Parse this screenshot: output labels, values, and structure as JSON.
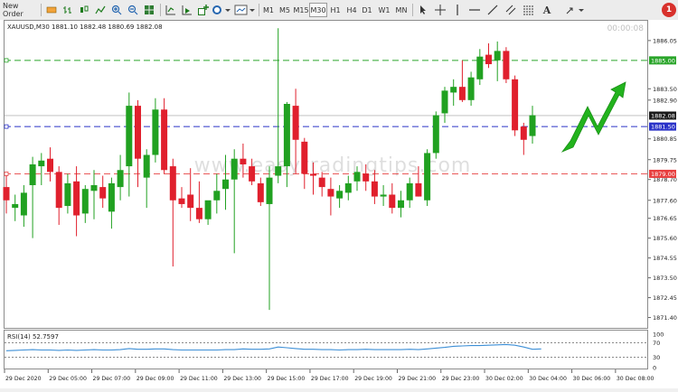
{
  "toolbar": {
    "new_order_label": "New Order",
    "timeframes": [
      "M1",
      "M5",
      "M15",
      "M30",
      "H1",
      "H4",
      "D1",
      "W1",
      "MN"
    ],
    "active_timeframe": "M30",
    "alert_badge": "1",
    "icons": [
      "auto-trading-icon",
      "bars-chart-icon",
      "candles-chart-icon",
      "line-chart-icon",
      "zoom-in-icon",
      "zoom-out-icon",
      "tile-windows-icon",
      "auto-scroll-icon",
      "chart-shift-icon",
      "indicators-icon",
      "period-icon",
      "templates-icon",
      "cursor-icon",
      "crosshair-icon",
      "vertical-line-icon",
      "horizontal-line-icon",
      "trendline-icon",
      "channel-icon",
      "fibonacci-icon",
      "text-icon",
      "arrows-icon"
    ]
  },
  "chart": {
    "header": "XAUUSD,M30  1881.10 1882.48 1880.69 1882.08",
    "timer": "00:00:08",
    "watermark": "www.easytradingtips.com",
    "rsi_label": "RSI(14) 52.7597",
    "colors": {
      "bull": "#21a121",
      "bear": "#e0202d",
      "rsi": "#3d8fd6",
      "green_line": "#2aa52a",
      "blue_line": "#2b33c8",
      "red_line": "#e84040",
      "arrow": "#22b31d"
    }
  },
  "chart_data": {
    "type": "candlestick",
    "symbol": "XAUUSD",
    "timeframe": "M30",
    "ylim": [
      1870.9,
      1887.0
    ],
    "price_ticks": [
      "1886.05",
      "1883.50",
      "1882.90",
      "1880.85",
      "1879.75",
      "1878.70",
      "1877.60",
      "1876.65",
      "1875.60",
      "1874.55",
      "1873.50",
      "1872.45",
      "1871.40"
    ],
    "price_labels": [
      "1886.05",
      "1883.50",
      "1882.90",
      "1880.85",
      "1879.75",
      "1878.70",
      "1877.60",
      "1876.65",
      "1875.60",
      "1874.55",
      "1873.50",
      "1872.45",
      "1871.40"
    ],
    "x_labels": [
      "29 Dec 2020",
      "29 Dec 05:00",
      "29 Dec 07:00",
      "29 Dec 09:00",
      "29 Dec 11:00",
      "29 Dec 13:00",
      "29 Dec 15:00",
      "29 Dec 17:00",
      "29 Dec 19:00",
      "29 Dec 21:00",
      "29 Dec 23:00",
      "30 Dec 02:00",
      "30 Dec 04:00",
      "30 Dec 06:00",
      "30 Dec 08:00"
    ],
    "levels": [
      {
        "price": 1885.0,
        "label": "1885.00",
        "style": "green-dashed"
      },
      {
        "price": 1881.5,
        "label": "1881.50",
        "style": "blue-dashed"
      },
      {
        "price": 1879.0,
        "label": "1879.00",
        "style": "red-dashed"
      },
      {
        "price": 1882.08,
        "label": "1882.08",
        "style": "current-price"
      }
    ],
    "candles": [
      {
        "o": 1878.3,
        "h": 1878.9,
        "l": 1876.9,
        "c": 1877.6
      },
      {
        "o": 1877.2,
        "h": 1877.9,
        "l": 1876.5,
        "c": 1877.4
      },
      {
        "o": 1876.8,
        "h": 1878.4,
        "l": 1876.2,
        "c": 1878.0
      },
      {
        "o": 1878.4,
        "h": 1879.9,
        "l": 1875.6,
        "c": 1879.5
      },
      {
        "o": 1879.4,
        "h": 1880.1,
        "l": 1878.4,
        "c": 1879.7
      },
      {
        "o": 1879.8,
        "h": 1880.4,
        "l": 1878.6,
        "c": 1879.1
      },
      {
        "o": 1879.1,
        "h": 1879.4,
        "l": 1876.3,
        "c": 1877.2
      },
      {
        "o": 1877.3,
        "h": 1879.0,
        "l": 1876.9,
        "c": 1878.5
      },
      {
        "o": 1878.6,
        "h": 1879.4,
        "l": 1875.7,
        "c": 1876.8
      },
      {
        "o": 1876.9,
        "h": 1878.4,
        "l": 1876.4,
        "c": 1878.2
      },
      {
        "o": 1878.1,
        "h": 1879.2,
        "l": 1876.6,
        "c": 1878.4
      },
      {
        "o": 1878.3,
        "h": 1878.9,
        "l": 1877.2,
        "c": 1877.7
      },
      {
        "o": 1877.0,
        "h": 1878.8,
        "l": 1876.1,
        "c": 1878.5
      },
      {
        "o": 1878.3,
        "h": 1880.0,
        "l": 1877.6,
        "c": 1879.2
      },
      {
        "o": 1879.4,
        "h": 1883.3,
        "l": 1877.8,
        "c": 1882.6
      },
      {
        "o": 1882.6,
        "h": 1882.9,
        "l": 1878.3,
        "c": 1879.8
      },
      {
        "o": 1878.8,
        "h": 1880.3,
        "l": 1877.2,
        "c": 1880.0
      },
      {
        "o": 1880.0,
        "h": 1883.0,
        "l": 1879.6,
        "c": 1882.4
      },
      {
        "o": 1882.4,
        "h": 1883.0,
        "l": 1879.0,
        "c": 1879.2
      },
      {
        "o": 1879.4,
        "h": 1879.8,
        "l": 1874.1,
        "c": 1877.6
      },
      {
        "o": 1877.7,
        "h": 1878.3,
        "l": 1877.2,
        "c": 1877.4
      },
      {
        "o": 1877.9,
        "h": 1879.3,
        "l": 1876.5,
        "c": 1877.2
      },
      {
        "o": 1877.2,
        "h": 1878.6,
        "l": 1876.4,
        "c": 1876.6
      },
      {
        "o": 1876.6,
        "h": 1877.5,
        "l": 1876.3,
        "c": 1877.6
      },
      {
        "o": 1877.6,
        "h": 1879.0,
        "l": 1876.9,
        "c": 1878.1
      },
      {
        "o": 1878.2,
        "h": 1880.0,
        "l": 1877.1,
        "c": 1878.7
      },
      {
        "o": 1878.7,
        "h": 1880.3,
        "l": 1874.8,
        "c": 1879.8
      },
      {
        "o": 1879.8,
        "h": 1880.6,
        "l": 1878.8,
        "c": 1879.5
      },
      {
        "o": 1879.4,
        "h": 1879.8,
        "l": 1878.4,
        "c": 1878.6
      },
      {
        "o": 1878.5,
        "h": 1878.8,
        "l": 1877.3,
        "c": 1877.5
      },
      {
        "o": 1877.4,
        "h": 1879.4,
        "l": 1871.8,
        "c": 1878.8
      },
      {
        "o": 1878.9,
        "h": 1886.7,
        "l": 1878.5,
        "c": 1879.4
      },
      {
        "o": 1879.4,
        "h": 1882.8,
        "l": 1878.3,
        "c": 1882.7
      },
      {
        "o": 1882.6,
        "h": 1883.5,
        "l": 1879.0,
        "c": 1880.8
      },
      {
        "o": 1880.7,
        "h": 1880.9,
        "l": 1878.2,
        "c": 1879.0
      },
      {
        "o": 1879.0,
        "h": 1879.6,
        "l": 1877.9,
        "c": 1878.9
      },
      {
        "o": 1878.8,
        "h": 1879.1,
        "l": 1877.8,
        "c": 1878.3
      },
      {
        "o": 1878.2,
        "h": 1878.8,
        "l": 1876.8,
        "c": 1877.8
      },
      {
        "o": 1877.7,
        "h": 1878.4,
        "l": 1877.2,
        "c": 1878.1
      },
      {
        "o": 1878.0,
        "h": 1878.9,
        "l": 1877.6,
        "c": 1878.5
      },
      {
        "o": 1878.6,
        "h": 1879.4,
        "l": 1878.1,
        "c": 1879.1
      },
      {
        "o": 1879.0,
        "h": 1879.5,
        "l": 1878.1,
        "c": 1878.6
      },
      {
        "o": 1878.6,
        "h": 1879.2,
        "l": 1877.4,
        "c": 1877.8
      },
      {
        "o": 1877.8,
        "h": 1878.4,
        "l": 1877.3,
        "c": 1877.9
      },
      {
        "o": 1877.9,
        "h": 1878.5,
        "l": 1876.9,
        "c": 1877.2
      },
      {
        "o": 1877.2,
        "h": 1878.1,
        "l": 1876.7,
        "c": 1877.6
      },
      {
        "o": 1877.6,
        "h": 1878.8,
        "l": 1877.2,
        "c": 1878.5
      },
      {
        "o": 1878.5,
        "h": 1879.4,
        "l": 1877.8,
        "c": 1877.8
      },
      {
        "o": 1877.6,
        "h": 1880.3,
        "l": 1877.3,
        "c": 1880.1
      },
      {
        "o": 1880.1,
        "h": 1882.3,
        "l": 1879.8,
        "c": 1882.1
      },
      {
        "o": 1882.2,
        "h": 1883.6,
        "l": 1881.7,
        "c": 1883.4
      },
      {
        "o": 1883.3,
        "h": 1884.0,
        "l": 1882.6,
        "c": 1883.6
      },
      {
        "o": 1883.6,
        "h": 1885.0,
        "l": 1882.8,
        "c": 1882.9
      },
      {
        "o": 1882.9,
        "h": 1884.4,
        "l": 1882.6,
        "c": 1884.1
      },
      {
        "o": 1884.0,
        "h": 1885.6,
        "l": 1883.7,
        "c": 1885.2
      },
      {
        "o": 1885.3,
        "h": 1885.9,
        "l": 1884.6,
        "c": 1884.8
      },
      {
        "o": 1885.0,
        "h": 1886.0,
        "l": 1883.9,
        "c": 1885.5
      },
      {
        "o": 1885.5,
        "h": 1885.7,
        "l": 1883.8,
        "c": 1884.0
      },
      {
        "o": 1884.0,
        "h": 1884.2,
        "l": 1881.0,
        "c": 1881.3
      },
      {
        "o": 1881.5,
        "h": 1881.7,
        "l": 1880.0,
        "c": 1880.8
      },
      {
        "o": 1881.0,
        "h": 1882.6,
        "l": 1880.6,
        "c": 1882.1
      }
    ],
    "rsi": [
      48,
      49,
      50,
      51,
      50,
      50,
      49,
      50,
      49,
      50,
      51,
      50,
      50,
      51,
      54,
      52,
      52,
      53,
      53,
      51,
      50,
      50,
      50,
      50,
      50,
      51,
      51,
      53,
      52,
      52,
      53,
      58,
      56,
      54,
      52,
      52,
      51,
      51,
      50,
      51,
      51,
      52,
      51,
      51,
      51,
      51,
      52,
      51,
      53,
      55,
      57,
      60,
      61,
      62,
      62,
      63,
      64,
      65,
      63,
      58,
      52,
      53
    ],
    "rsi_levels": [
      70,
      30
    ],
    "rsi_ticks": [
      "100",
      "70",
      "30",
      "0"
    ]
  }
}
